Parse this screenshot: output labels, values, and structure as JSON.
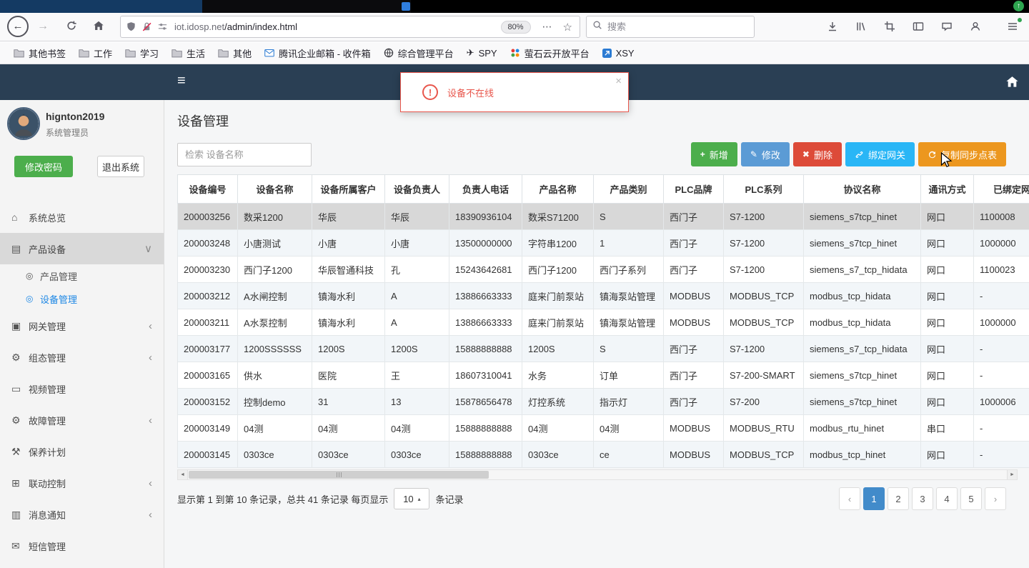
{
  "colors": {
    "app_header": "#2a3f54",
    "active_menu": "#1e88e5",
    "alert_red": "#e8564c",
    "active_page_blue": "#428bca"
  },
  "browser": {
    "update_badge": "↑",
    "toolbar": {
      "url_host": "iot.idosp.net",
      "url_path": "/admin/index.html",
      "zoom": "80%",
      "overflow": "⋯",
      "star": "☆",
      "search_placeholder": "搜索"
    },
    "bookmarks": [
      {
        "label": "其他书签",
        "icon": "folder"
      },
      {
        "label": "工作",
        "icon": "folder"
      },
      {
        "label": "学习",
        "icon": "folder"
      },
      {
        "label": "生活",
        "icon": "folder"
      },
      {
        "label": "其他",
        "icon": "folder"
      },
      {
        "label": "腾讯企业邮箱 - 收件箱",
        "icon": "tencent-mail"
      },
      {
        "label": "综合管理平台",
        "icon": "globe"
      },
      {
        "label": "SPY",
        "icon": "plane"
      },
      {
        "label": "萤石云开放平台",
        "icon": "ezviz"
      },
      {
        "label": "XSY",
        "icon": "xsy"
      }
    ]
  },
  "app": {
    "header": {
      "menu_icon": "≡"
    },
    "alert": {
      "message": "设备不在线",
      "close": "×"
    },
    "sidebar": {
      "username": "hignton2019",
      "role": "系统管理员",
      "change_password": "修改密码",
      "logout": "退出系统",
      "menu": [
        {
          "key": "overview",
          "label": "系统总览",
          "icon": "home",
          "type": "item"
        },
        {
          "key": "product-device",
          "label": "产品设备",
          "icon": "book",
          "type": "parent-open",
          "chevron": "∨"
        },
        {
          "key": "product-mgmt",
          "label": "产品管理",
          "icon": "target",
          "type": "sub"
        },
        {
          "key": "device-mgmt",
          "label": "设备管理",
          "icon": "target",
          "type": "sub",
          "active": true
        },
        {
          "key": "gateway-mgmt",
          "label": "网关管理",
          "icon": "idcard",
          "type": "item",
          "chevron": "‹"
        },
        {
          "key": "scada-mgmt",
          "label": "组态管理",
          "icon": "gears",
          "type": "item",
          "chevron": "‹"
        },
        {
          "key": "video-mgmt",
          "label": "视频管理",
          "icon": "monitor",
          "type": "item"
        },
        {
          "key": "fault-mgmt",
          "label": "故障管理",
          "icon": "gears",
          "type": "item",
          "chevron": "‹"
        },
        {
          "key": "maintain-plan",
          "label": "保养计划",
          "icon": "wrench",
          "type": "item"
        },
        {
          "key": "linkage-ctrl",
          "label": "联动控制",
          "icon": "sitemap",
          "type": "item",
          "chevron": "‹"
        },
        {
          "key": "message-notify",
          "label": "消息通知",
          "icon": "layers",
          "type": "item",
          "chevron": "‹"
        },
        {
          "key": "sms-mgmt",
          "label": "短信管理",
          "icon": "mail",
          "type": "item"
        }
      ]
    },
    "main": {
      "title": "设备管理",
      "search_placeholder": "检索 设备名称",
      "buttons": [
        {
          "key": "add",
          "label": "新增",
          "icon": "plus",
          "color": "#4cae4c"
        },
        {
          "key": "edit",
          "label": "修改",
          "icon": "pencil",
          "color": "#5b9bd5"
        },
        {
          "key": "delete",
          "label": "删除",
          "icon": "cross",
          "color": "#dd4b39"
        },
        {
          "key": "bind-gateway",
          "label": "绑定网关",
          "icon": "link",
          "color": "#29b6f6"
        },
        {
          "key": "copy-sync",
          "label": "复制同步点表",
          "icon": "refresh",
          "color": "#ec971f"
        }
      ],
      "table": {
        "headers": [
          "设备编号",
          "设备名称",
          "设备所属客户",
          "设备负责人",
          "负责人电话",
          "产品名称",
          "产品类别",
          "PLC品牌",
          "PLC系列",
          "协议名称",
          "通讯方式",
          "已绑定网关"
        ],
        "rows": [
          {
            "selected": true,
            "cells": [
              "200003256",
              "数采1200",
              "华辰",
              "华辰",
              "18390936104",
              "数采S71200",
              "S",
              "西门子",
              "S7-1200",
              "siemens_s7tcp_hinet",
              "网口",
              "1100008"
            ]
          },
          {
            "cells": [
              "200003248",
              "小唐测试",
              "小唐",
              "小唐",
              "13500000000",
              "字符串1200",
              "1",
              "西门子",
              "S7-1200",
              "siemens_s7tcp_hinet",
              "网口",
              "1000000"
            ]
          },
          {
            "cells": [
              "200003230",
              "西门子1200",
              "华辰智通科技",
              "孔",
              "15243642681",
              "西门子1200",
              "西门子系列",
              "西门子",
              "S7-1200",
              "siemens_s7_tcp_hidata",
              "网口",
              "1100023"
            ]
          },
          {
            "cells": [
              "200003212",
              "A水闸控制",
              "镇海水利",
              "A",
              "13886663333",
              "庭来门前泵站",
              "镇海泵站管理",
              "MODBUS",
              "MODBUS_TCP",
              "modbus_tcp_hidata",
              "网口",
              "-"
            ]
          },
          {
            "cells": [
              "200003211",
              "A水泵控制",
              "镇海水利",
              "A",
              "13886663333",
              "庭来门前泵站",
              "镇海泵站管理",
              "MODBUS",
              "MODBUS_TCP",
              "modbus_tcp_hidata",
              "网口",
              "1000000"
            ]
          },
          {
            "cells": [
              "200003177",
              "1200SSSSSS",
              "1200S",
              "1200S",
              "15888888888",
              "1200S",
              "S",
              "西门子",
              "S7-1200",
              "siemens_s7_tcp_hidata",
              "网口",
              "-"
            ]
          },
          {
            "cells": [
              "200003165",
              "供水",
              "医院",
              "王",
              "18607310041",
              "水务",
              "订单",
              "西门子",
              "S7-200-SMART",
              "siemens_s7tcp_hinet",
              "网口",
              "-"
            ]
          },
          {
            "cells": [
              "200003152",
              "控制demo",
              "31",
              "13",
              "15878656478",
              "灯控系统",
              "指示灯",
              "西门子",
              "S7-200",
              "siemens_s7tcp_hinet",
              "网口",
              "1000006"
            ]
          },
          {
            "cells": [
              "200003149",
              "04测",
              "04测",
              "04测",
              "15888888888",
              "04测",
              "04测",
              "MODBUS",
              "MODBUS_RTU",
              "modbus_rtu_hinet",
              "串口",
              "-"
            ]
          },
          {
            "cells": [
              "200003145",
              "0303ce",
              "0303ce",
              "0303ce",
              "15888888888",
              "0303ce",
              "ce",
              "MODBUS",
              "MODBUS_TCP",
              "modbus_tcp_hinet",
              "网口",
              "-"
            ]
          }
        ]
      },
      "pagination": {
        "summary_before": "显示第 1 到第 10 条记录，总共 41 条记录 每页显示",
        "page_size": "10",
        "size_caret": "▴",
        "summary_after": "条记录",
        "prev": "‹",
        "next": "›",
        "pages": [
          "1",
          "2",
          "3",
          "4",
          "5"
        ],
        "active_page": "1"
      }
    }
  }
}
